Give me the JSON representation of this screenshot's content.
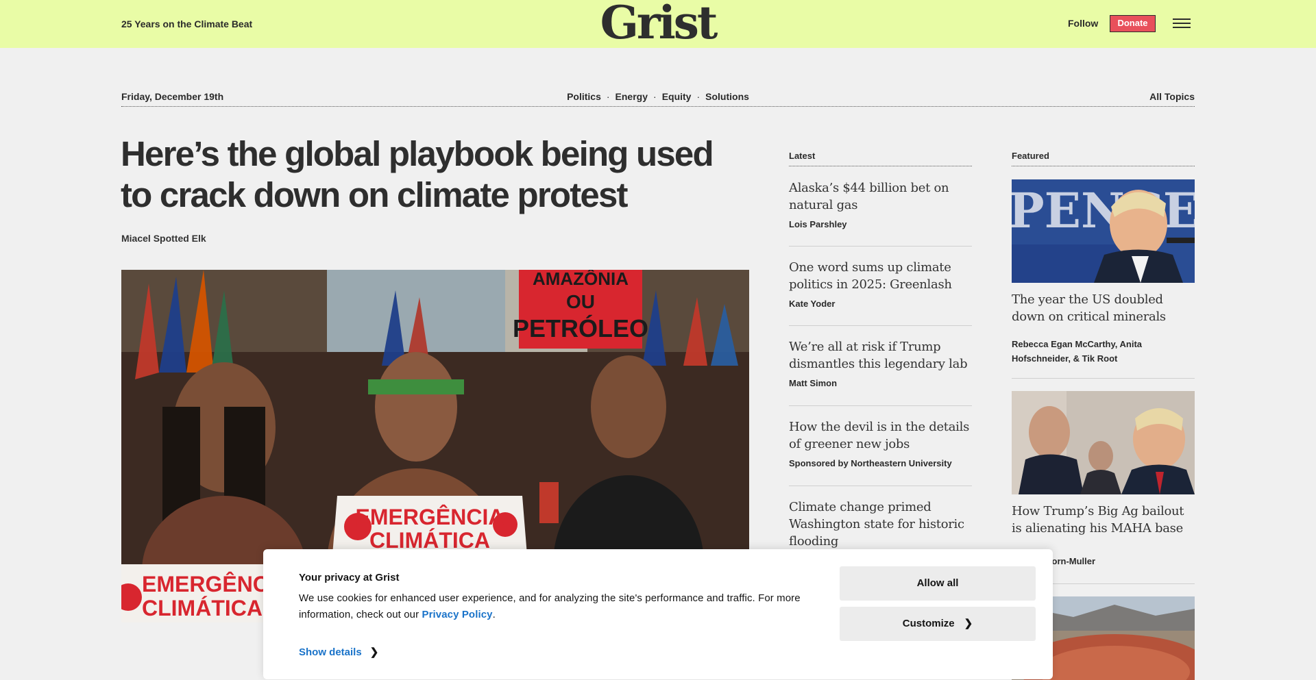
{
  "header": {
    "tagline": "25 Years on the Climate Beat",
    "logo": "Grist",
    "follow": "Follow",
    "donate": "Donate",
    "menu_icon": "hamburger-menu-icon"
  },
  "subnav": {
    "date": "Friday, December 19th",
    "topics": [
      "Politics",
      "Energy",
      "Equity",
      "Solutions"
    ],
    "separator": "·",
    "all_topics": "All Topics"
  },
  "main_story": {
    "headline": "Here’s the global playbook being used to crack down on climate protest",
    "author": "Miacel Spotted Elk",
    "image_signs": {
      "top_sign_1": "AMAZÔNIA",
      "top_sign_2": "OU",
      "top_sign_3": "PETRÓLEO",
      "banner_1": "EMERGÊNCIA",
      "banner_2": "CLIMÁTICA",
      "banner_left_1": "EMERGÊNCIA",
      "banner_left_2": "CLIMÁTICA"
    }
  },
  "latest": {
    "heading": "Latest",
    "items": [
      {
        "title": "Alaska’s $44 billion bet on natural gas",
        "author": "Lois Parshley"
      },
      {
        "title": "One word sums up climate politics in 2025: Greenlash",
        "author": "Kate Yoder"
      },
      {
        "title": "We’re all at risk if Trump dismantles this legendary lab",
        "author": "Matt Simon"
      },
      {
        "title": "How the devil is in the details of greener new jobs",
        "author": "Sponsored by Northeastern University"
      },
      {
        "title": "Climate change primed Washington state for historic flooding",
        "author": ""
      }
    ]
  },
  "featured": {
    "heading": "Featured",
    "items": [
      {
        "title": "The year the US doubled down on critical minerals",
        "authors": "Rebecca Egan McCarthy, Anita Hofschneider, & Tik Root",
        "image_text": "PENCE"
      },
      {
        "title": "How Trump’s Big Ag bailout is alienating his MAHA base",
        "authors": "...urella Horn-Muller"
      }
    ]
  },
  "cookie_banner": {
    "title": "Your privacy at Grist",
    "text": "We use cookies for enhanced user experience, and for analyzing the site's performance and traffic. For more information, check out our",
    "link": "Privacy Policy",
    "period": ".",
    "show_details": "Show details",
    "allow_all": "Allow all",
    "customize": "Customize"
  },
  "colors": {
    "header_bg": "#e9fca6",
    "page_bg": "#f0f0f0",
    "donate_bg": "#e8505b",
    "link_blue": "#1a73c9"
  }
}
